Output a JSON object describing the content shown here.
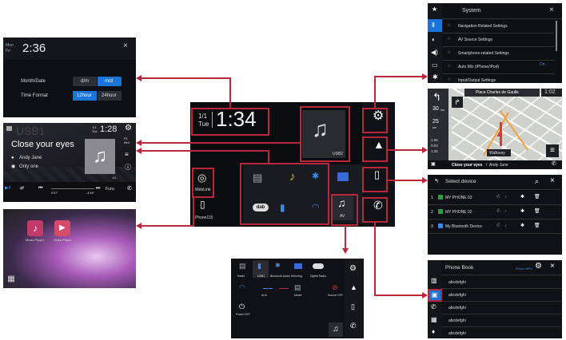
{
  "clock_panel": {
    "date_line1": "Mon",
    "date_line2": "Fri",
    "time": "2:36",
    "close": "×",
    "month_label": "Month/Date",
    "month_opts": [
      "d/m",
      "m/d"
    ],
    "time_label": "Time Format",
    "time_opts": [
      "12hour",
      "24hour"
    ]
  },
  "av_panel": {
    "source": "USB1",
    "date": "1/1",
    "day": "Tue",
    "time": "1:28",
    "title": "Close your eyes",
    "artist": "Andy Jane",
    "album": "Only one",
    "track": "1/1",
    "elapsed": "0'07\"",
    "remaining": "-4'49\"",
    "func": "Func.",
    "bell": "Bell",
    "pi": "P1"
  },
  "top_menu_panel": {
    "apps": [
      "Music Player",
      "Video Player"
    ]
  },
  "home": {
    "date": "1/1",
    "day": "Tue",
    "time": "1:34",
    "usb_label": "USB2",
    "weblink": "WebLink",
    "phone_label": "Phone115",
    "av_label": "AV"
  },
  "source_list": {
    "items": [
      "Radio",
      "USB1",
      "Bluetooth Audio",
      "Mirroring",
      "Digital Radio",
      "AUX",
      "Mixed",
      "Source OFF",
      "Power OFF"
    ]
  },
  "system_panel": {
    "title": "System",
    "close": "×",
    "items": [
      "Navigation Related Settings",
      "AV Source Settings",
      "Smartphone-related Settings",
      "Auto Mix (iPhone/iPod)",
      "Input/Output Settings"
    ],
    "automix_state": "On"
  },
  "nav_panel": {
    "street": "Place Charles de Gaulle",
    "time": "1:02",
    "dist1": "30",
    "dist1_unit": "km",
    "dist2": "25",
    "dist2_unit": "km",
    "stat1": "1.06",
    "stat2": "0:03",
    "stat3": "1:25",
    "walk": "Walkway",
    "song": "Close your eyes",
    "artist": "Andy Jane"
  },
  "device_panel": {
    "title": "Select device",
    "devices": [
      {
        "num": "1",
        "name": "MY PHONE 03"
      },
      {
        "num": "2",
        "name": "MY PHONE 02"
      },
      {
        "num": "3",
        "name": "My Bluetooth Device"
      }
    ]
  },
  "phonebook_panel": {
    "title": "Phone Book",
    "device": "iPhone 06Pro",
    "entries": [
      "abcdefghi",
      "abcdefghi",
      "abcdefghi",
      "abcdefghi",
      "abcdefghi"
    ]
  }
}
